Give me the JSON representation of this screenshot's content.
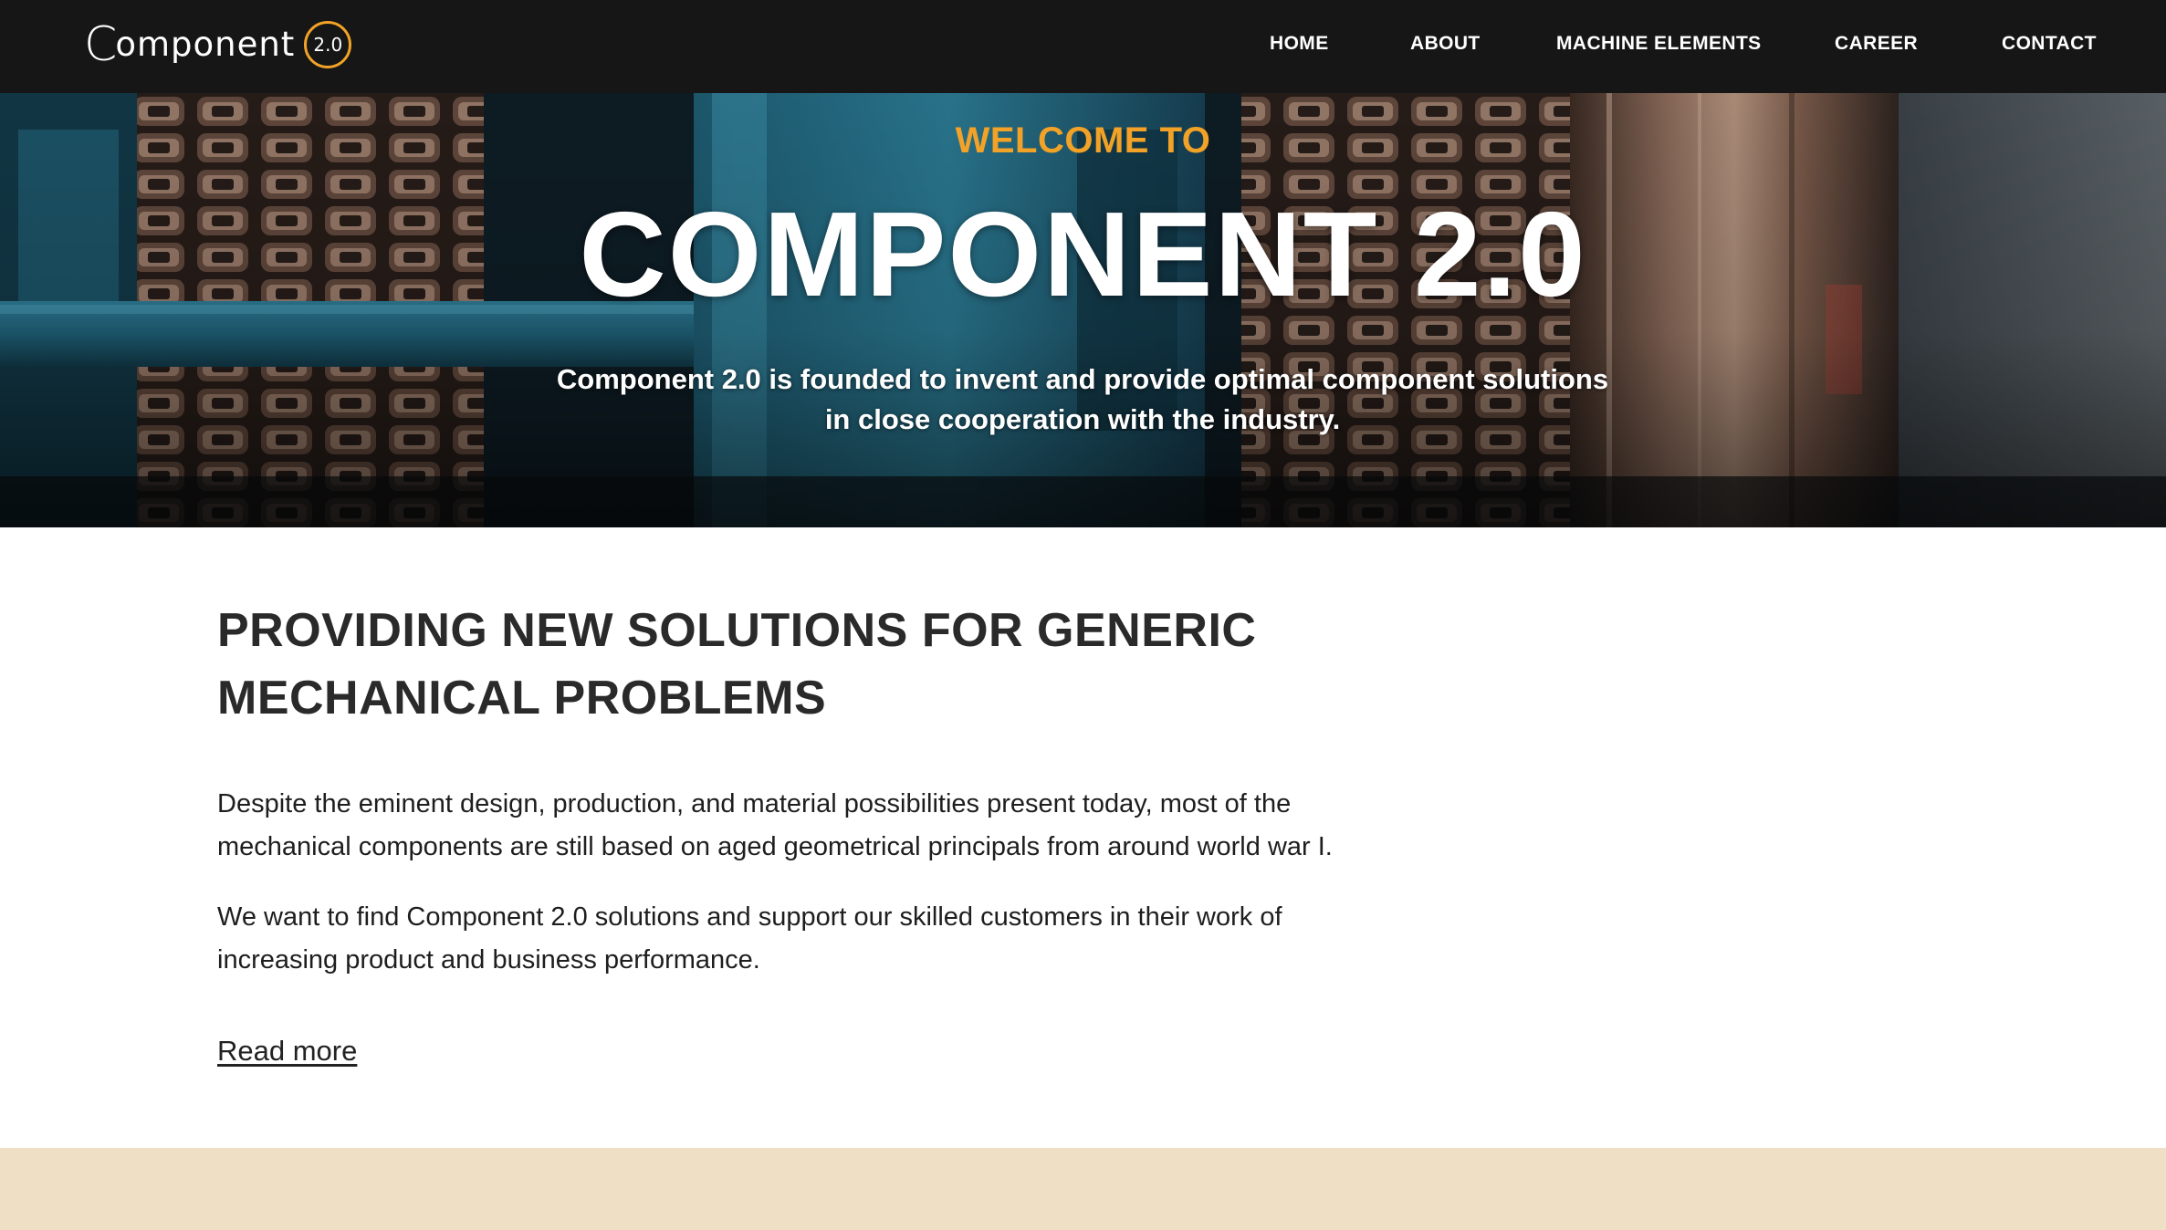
{
  "brand": {
    "logo_c": "C",
    "logo_rest": "omponent",
    "logo_badge": "2.0",
    "accent_color": "#f2a227"
  },
  "nav": {
    "items": [
      {
        "label": "HOME"
      },
      {
        "label": "ABOUT"
      },
      {
        "label": "MACHINE ELEMENTS"
      },
      {
        "label": "CAREER"
      },
      {
        "label": "CONTACT"
      }
    ]
  },
  "hero": {
    "kicker": "WELCOME TO",
    "title": "COMPONENT 2.0",
    "subtitle_line1": "Component 2.0 is founded to invent and provide optimal component solutions",
    "subtitle_line2": "in close cooperation with the industry."
  },
  "main": {
    "headline_line1": "PROVIDING NEW SOLUTIONS FOR GENERIC",
    "headline_line2": "MECHANICAL PROBLEMS",
    "paragraph1_line1": "Despite the eminent design, production, and material possibilities present today, most of the",
    "paragraph1_line2": "mechanical components are still based on aged geometrical principals from around world war I.",
    "paragraph2_line1": "We want to find Component 2.0 solutions and support our skilled customers in their work of",
    "paragraph2_line2": "increasing product and business performance.",
    "read_more": "Read more"
  },
  "colors": {
    "topbar": "#161616",
    "footer_band": "#efdfc5",
    "text": "#2a2a2a"
  }
}
